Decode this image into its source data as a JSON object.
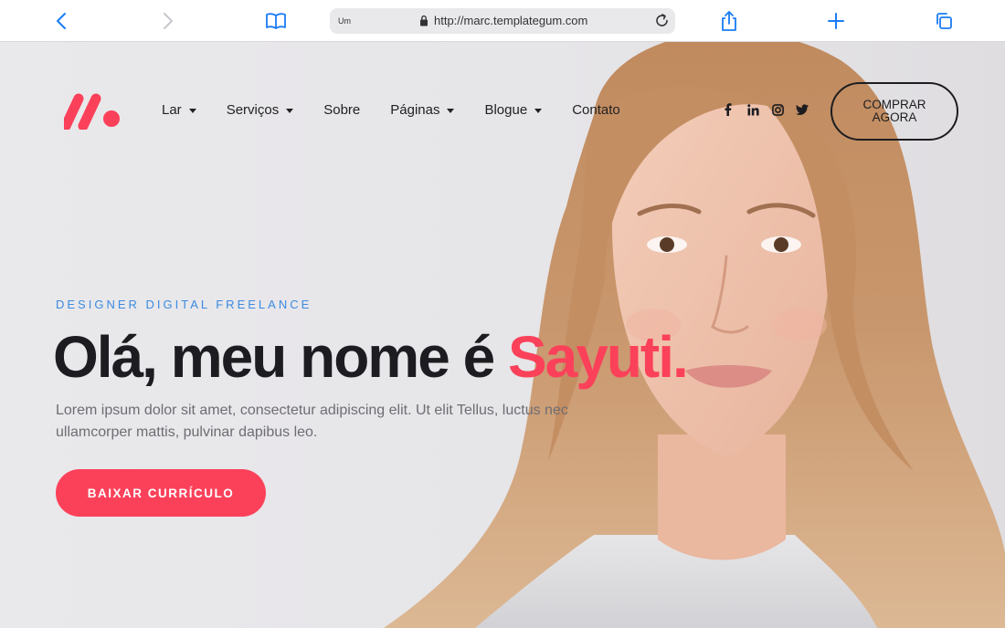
{
  "browser": {
    "tab_label": "Um",
    "url": "http://marc.templategum.com"
  },
  "nav": {
    "items": [
      {
        "label": "Lar",
        "has_dropdown": true
      },
      {
        "label": "Serviços",
        "has_dropdown": true
      },
      {
        "label": "Sobre",
        "has_dropdown": false
      },
      {
        "label": "Páginas",
        "has_dropdown": true
      },
      {
        "label": "Blogue",
        "has_dropdown": true
      },
      {
        "label": "Contato",
        "has_dropdown": false
      }
    ],
    "social_icons": [
      "facebook-icon",
      "linkedin-icon",
      "instagram-icon",
      "twitter-icon"
    ],
    "buy_label": "COMPRAR AGORA"
  },
  "hero": {
    "eyebrow": "DESIGNER DIGITAL FREELANCE",
    "title_prefix": "Olá, meu nome é ",
    "title_name": "Sayuti.",
    "description": "Lorem ipsum dolor sit amet, consectetur adipiscing elit. Ut elit Tellus, luctus nec ullamcorper mattis, pulvinar dapibus leo.",
    "cta_label": "BAIXAR CURRÍCULO"
  },
  "colors": {
    "accent": "#fb415a",
    "eyebrow": "#3b8be0",
    "heading": "#1d1c21",
    "ios_blue": "#1a7cf5"
  }
}
